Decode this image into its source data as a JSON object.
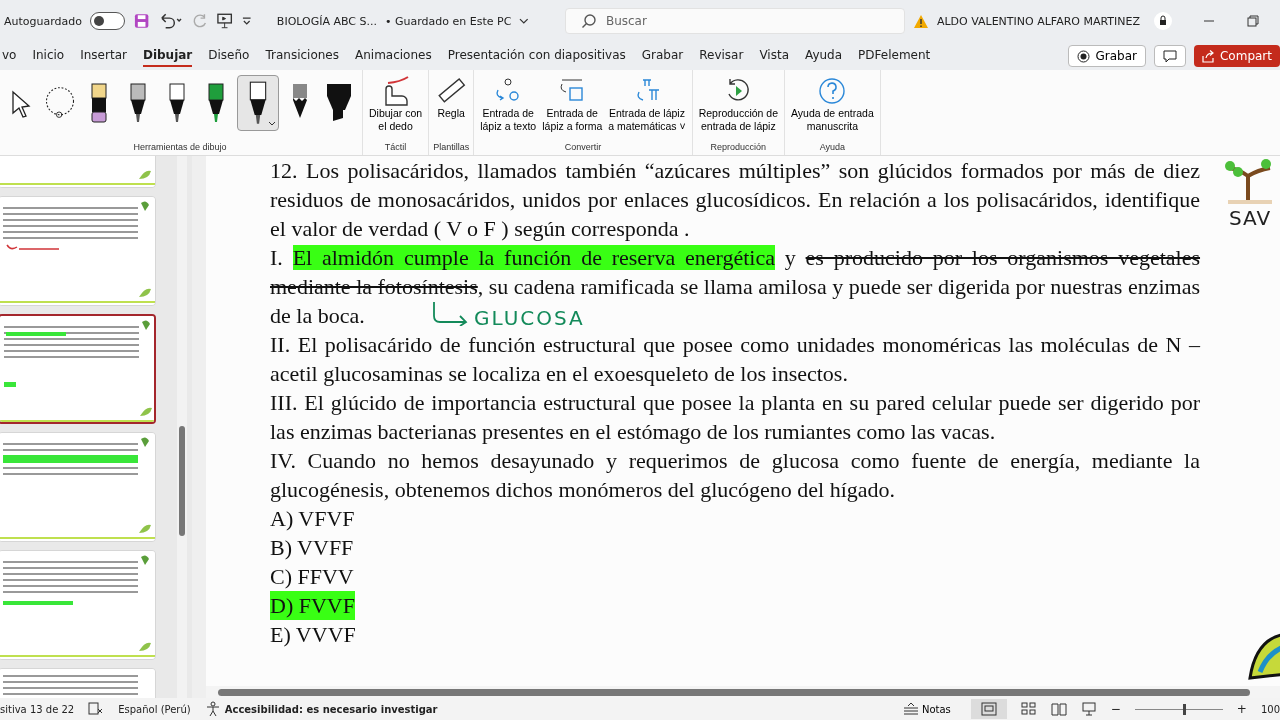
{
  "title_bar": {
    "autosave_label": "Autoguardado",
    "autosave_on": false,
    "file_name": "BIOLOGÍA ABC S...",
    "save_status": "• Guardado en Este PC",
    "search": {
      "placeholder": "Buscar"
    },
    "user_name": "ALDO VALENTINO ALFARO MARTINEZ"
  },
  "tabs": [
    {
      "label": "vo",
      "selected": false
    },
    {
      "label": "Inicio",
      "selected": false
    },
    {
      "label": "Insertar",
      "selected": false
    },
    {
      "label": "Dibujar",
      "selected": true
    },
    {
      "label": "Diseño",
      "selected": false
    },
    {
      "label": "Transiciones",
      "selected": false
    },
    {
      "label": "Animaciones",
      "selected": false
    },
    {
      "label": "Presentación con diapositivas",
      "selected": false
    },
    {
      "label": "Grabar",
      "selected": false
    },
    {
      "label": "Revisar",
      "selected": false
    },
    {
      "label": "Vista",
      "selected": false
    },
    {
      "label": "Ayuda",
      "selected": false
    },
    {
      "label": "PDFelement",
      "selected": false
    }
  ],
  "tab_actions": {
    "record": "Grabar",
    "share": "Compart"
  },
  "ribbon": {
    "drawing_tools": {
      "label": "Herramientas de dibujo",
      "tools": [
        {
          "kind": "select",
          "selected": false
        },
        {
          "kind": "lasso",
          "selected": false
        },
        {
          "kind": "eraser",
          "selected": false
        },
        {
          "kind": "pen",
          "selected": false
        },
        {
          "kind": "pen",
          "selected": false
        },
        {
          "kind": "pen",
          "selected": false,
          "color": "#1f9e3c"
        },
        {
          "kind": "pen",
          "selected": true
        },
        {
          "kind": "pencil",
          "selected": false
        },
        {
          "kind": "highlighter",
          "selected": false
        }
      ]
    },
    "groups": [
      {
        "label": "Táctil",
        "buttons": [
          "Dibujar con\nel dedo"
        ]
      },
      {
        "label": "Plantillas",
        "buttons": [
          "Regla"
        ]
      },
      {
        "label": "Convertir",
        "buttons": [
          "Entrada de\nlápiz a texto",
          "Entrada de\nlápiz a forma",
          "Entrada de lápiz\na matemáticas ˅"
        ]
      },
      {
        "label": "Reproducción",
        "buttons": [
          "Reproducción de\nentrada de lápiz"
        ]
      },
      {
        "label": "Ayuda",
        "buttons": [
          "Ayuda de entrada\nmanuscrita"
        ]
      }
    ]
  },
  "thumbnails": [
    {
      "kind": "partial",
      "selected": false
    },
    {
      "kind": "notes",
      "selected": false
    },
    {
      "kind": "question",
      "selected": true
    },
    {
      "kind": "highlight",
      "selected": false
    },
    {
      "kind": "options",
      "selected": false
    },
    {
      "kind": "partial_top",
      "selected": false
    }
  ],
  "slide": {
    "intro": "12. Los polisacáridos, llamados también “azúcares múltiples” son glúcidos formados por más de diez residuos de monosacáridos, unidos por enlaces glucosídicos. En relación a los polisacáridos, identifique el valor de verdad ( V o F ) según corresponda .",
    "statement_1": [
      {
        "text": "I.",
        "highlighted": false,
        "struck": false
      },
      {
        "text": "El almidón cumple la función de reserva energética",
        "highlighted": true,
        "struck": false
      },
      {
        "text": "y",
        "highlighted": false,
        "struck": false
      },
      {
        "text": "es producido por los organismos vegetales mediante la fotosíntesis",
        "highlighted": false,
        "struck": true
      },
      {
        "text": ", su cadena ramificada se llama amilosa y puede ser digerida por nuestras enzimas de la boca.",
        "highlighted": false,
        "struck": false
      }
    ],
    "annotation": "GLUCOSA",
    "statements": [
      "II. El polisacárido de función estructural que posee como unidades monoméricas las moléculas de N – acetil glucosaminas se localiza en el exoesqueleto de los insectos.",
      "III. El glúcido de importancia estructural que posee la planta en su pared celular puede ser digerido por las enzimas bacterianas presentes en el estómago de los rumiantes como las vacas.",
      "IV. Cuando no hemos desayunado y requerimos de glucosa como fuente de energía, mediante la glucogénesis, obtenemos dichos monómeros del glucógeno del hígado."
    ],
    "options": [
      {
        "text": "A) VFVF",
        "selected": false
      },
      {
        "text": "B) VVFF",
        "selected": false
      },
      {
        "text": "C) FFVV",
        "selected": false
      },
      {
        "text": "D) FVVF",
        "selected": true
      },
      {
        "text": "E) VVVF",
        "selected": false
      }
    ],
    "logo_text": "SAV"
  },
  "status_bar": {
    "slide_counter": "sitiva 13 de 22",
    "language": "Español (Perú)",
    "accessibility": "Accesibilidad: es necesario investigar",
    "notes": "Notas",
    "zoom_out": "−",
    "zoom_in": "+",
    "zoom": "100",
    "zoom_slider": {
      "level": 0.55
    }
  }
}
